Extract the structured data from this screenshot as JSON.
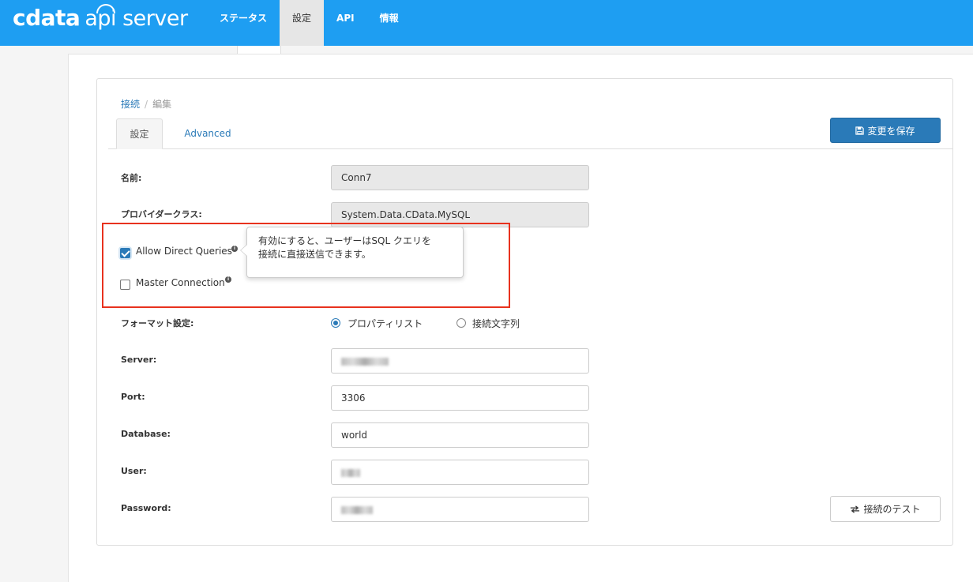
{
  "header": {
    "logo_brand": "cdata",
    "logo_text": "api server",
    "nav": [
      {
        "label": "ステータス"
      },
      {
        "label": "設定"
      },
      {
        "label": "API"
      },
      {
        "label": "情報"
      }
    ],
    "active_nav": "設定"
  },
  "breadcrumb": {
    "parent": "接続",
    "current": "編集"
  },
  "tabs": [
    {
      "label": "設定"
    },
    {
      "label": "Advanced"
    }
  ],
  "save_label": "変更を保存",
  "form": {
    "name_label": "名前:",
    "name_value": "Conn7",
    "provider_label": "プロバイダークラス:",
    "provider_value": "System.Data.CData.MySQL",
    "allow_direct_label": "Allow Direct Queries",
    "allow_direct_checked": true,
    "master_label": "Master Connection",
    "master_checked": false,
    "format_label": "フォーマット設定:",
    "format_options": [
      {
        "label": "プロパティリスト",
        "selected": true
      },
      {
        "label": "接続文字列",
        "selected": false
      }
    ],
    "server_label": "Server:",
    "port_label": "Port:",
    "port_value": "3306",
    "database_label": "Database:",
    "database_value": "world",
    "user_label": "User:",
    "password_label": "Password:"
  },
  "tooltip": {
    "line1": "有効にすると、ユーザーはSQL クエリを",
    "line2": "接続に直接送信できます。"
  },
  "test_label": "接続のテスト",
  "colors": {
    "header": "#1e9ef2",
    "primary": "#2a7ab8",
    "highlight": "#e8321e"
  },
  "icons": {
    "save": "floppy-icon",
    "test": "arrows-exchange-icon",
    "info": "info-icon"
  }
}
